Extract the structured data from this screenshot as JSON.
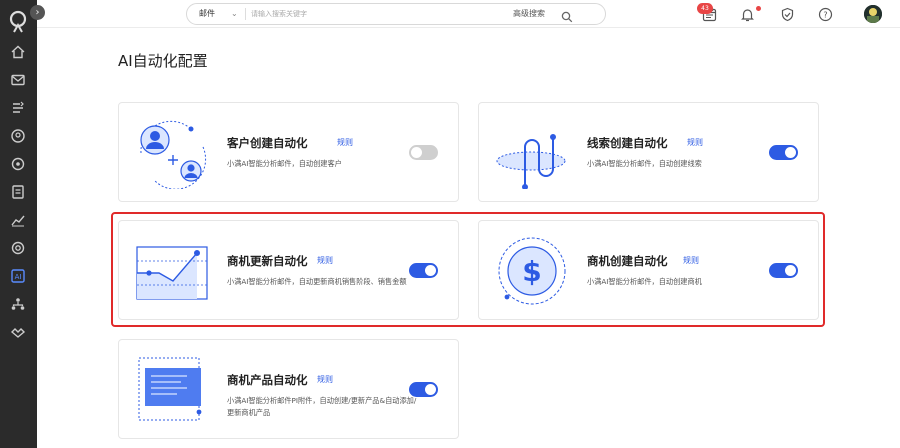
{
  "header": {
    "search": {
      "scope": "邮件",
      "placeholder": "请输入搜索关键字",
      "advanced_label": "高级搜索"
    },
    "notification_count": "43"
  },
  "page": {
    "title": "AI自动化配置"
  },
  "cards": [
    {
      "title": "客户创建自动化",
      "rule_label": "规则",
      "desc": "小满AI智能分析邮件，自动创建客户",
      "enabled": false
    },
    {
      "title": "线索创建自动化",
      "rule_label": "规则",
      "desc": "小满AI智能分析邮件，自动创建线索",
      "enabled": true
    },
    {
      "title": "商机更新自动化",
      "rule_label": "规则",
      "desc": "小满AI智能分析邮件，自动更新商机销售阶段、销售金额",
      "enabled": true
    },
    {
      "title": "商机创建自动化",
      "rule_label": "规则",
      "desc": "小满AI智能分析邮件，自动创建商机",
      "enabled": true
    },
    {
      "title": "商机产品自动化",
      "rule_label": "规则",
      "desc": "小满AI智能分析邮件PI附件，自动创建/更新产品&自动添加/更新商机产品",
      "enabled": true
    }
  ],
  "colors": {
    "accent": "#2d5be3",
    "highlight_border": "#e02a2a",
    "sidebar_bg": "#2b2b2b",
    "badge": "#e84545"
  },
  "icons": {
    "sidebar": [
      "logo-icon",
      "home-icon",
      "mail-icon",
      "leads-icon",
      "customer-icon",
      "opportunity-icon",
      "document-icon",
      "statistics-icon",
      "settings-icon",
      "ai-icon",
      "org-icon",
      "partner-icon"
    ],
    "header": [
      "calendar-icon",
      "bell-icon",
      "shield-icon",
      "help-icon"
    ]
  }
}
